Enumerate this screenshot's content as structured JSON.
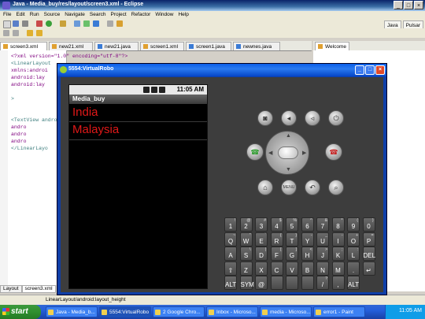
{
  "eclipse": {
    "title": "Java - Media_buy/res/layout/screen3.xml - Eclipse",
    "menu": [
      "File",
      "Edit",
      "Run",
      "Source",
      "Navigate",
      "Search",
      "Project",
      "Refactor",
      "Window",
      "Help"
    ],
    "perspectives": [
      "Java",
      "Pulsar"
    ],
    "tabs": [
      {
        "label": "screen3.xml",
        "type": "xml",
        "active": true
      },
      {
        "label": "new21.xml",
        "type": "xml"
      },
      {
        "label": "new21.java",
        "type": "java"
      },
      {
        "label": "screen1.xml",
        "type": "xml"
      },
      {
        "label": "screen1.java",
        "type": "java"
      },
      {
        "label": "newnes.java",
        "type": "java"
      }
    ],
    "welcome_tab": "Welcome",
    "code_lines": [
      "<?xml version=\"1.0\" encoding=\"utf-8\"?>",
      "<LinearLayout",
      "  xmlns:androi",
      "  android:lay",
      "  android:lay",
      "",
      "  >",
      "",
      "",
      "<TextView andro",
      "        andro",
      "        andro",
      "        andro",
      "</LinearLayo"
    ],
    "bottom_tabs": [
      "Layout",
      "screen3.xml"
    ],
    "status_text": "LinearLayout/android:layout_height"
  },
  "emulator": {
    "title": "5554:VirtualRobo",
    "clock": "11:05 AM",
    "app_title": "Media_buy",
    "list_items": [
      "India",
      "Malaysia"
    ],
    "buttons": {
      "camera": "camera",
      "vol_down": "volume-down",
      "vol_up": "volume-up",
      "power": "power",
      "call": "call",
      "end": "end-call",
      "home": "home",
      "menu": "MENU",
      "back": "back",
      "search": "search"
    },
    "keyboard_rows": [
      [
        [
          "1",
          "!"
        ],
        [
          "2",
          "@"
        ],
        [
          "3",
          "#"
        ],
        [
          "4",
          "$"
        ],
        [
          "5",
          "%"
        ],
        [
          "6",
          "^"
        ],
        [
          "7",
          "&"
        ],
        [
          "8",
          "*"
        ],
        [
          "9",
          "("
        ],
        [
          "0",
          ")"
        ]
      ],
      [
        [
          "Q",
          "~"
        ],
        [
          "W",
          "\""
        ],
        [
          "E",
          "`"
        ],
        [
          "R",
          "{"
        ],
        [
          "T",
          "}"
        ],
        [
          "Y",
          "-"
        ],
        [
          "U",
          "_"
        ],
        [
          "I",
          "-"
        ],
        [
          "O",
          "+"
        ],
        [
          "P",
          "="
        ]
      ],
      [
        [
          "A",
          ""
        ],
        [
          "S",
          "\\"
        ],
        [
          "D",
          "|"
        ],
        [
          "F",
          "["
        ],
        [
          "G",
          "]"
        ],
        [
          "H",
          "<"
        ],
        [
          "J",
          ">"
        ],
        [
          "K",
          ";"
        ],
        [
          "L",
          ":"
        ],
        [
          "DEL",
          ""
        ]
      ],
      [
        [
          "⇧",
          ""
        ],
        [
          "Z",
          ""
        ],
        [
          "X",
          ""
        ],
        [
          "C",
          ""
        ],
        [
          "V",
          ""
        ],
        [
          "B",
          ""
        ],
        [
          "N",
          ""
        ],
        [
          "M",
          ""
        ],
        [
          ".",
          ""
        ],
        [
          "↵",
          ""
        ]
      ],
      [
        [
          "ALT",
          ""
        ],
        [
          "SYM",
          ""
        ],
        [
          "@",
          ""
        ],
        [
          "",
          ""
        ],
        [
          "",
          ""
        ],
        [
          "",
          ""
        ],
        [
          "/",
          "?"
        ],
        [
          ",",
          ""
        ],
        [
          "ALT",
          ""
        ]
      ]
    ]
  },
  "taskbar": {
    "start": "start",
    "items": [
      {
        "label": "Java - Media_b..."
      },
      {
        "label": "5554:VirtualRobo",
        "active": true
      },
      {
        "label": "2 Google Chro..."
      },
      {
        "label": "Inbox - Microso..."
      },
      {
        "label": "media - Microso..."
      },
      {
        "label": "error1 - Paint"
      }
    ],
    "clock": "11:05 AM"
  }
}
